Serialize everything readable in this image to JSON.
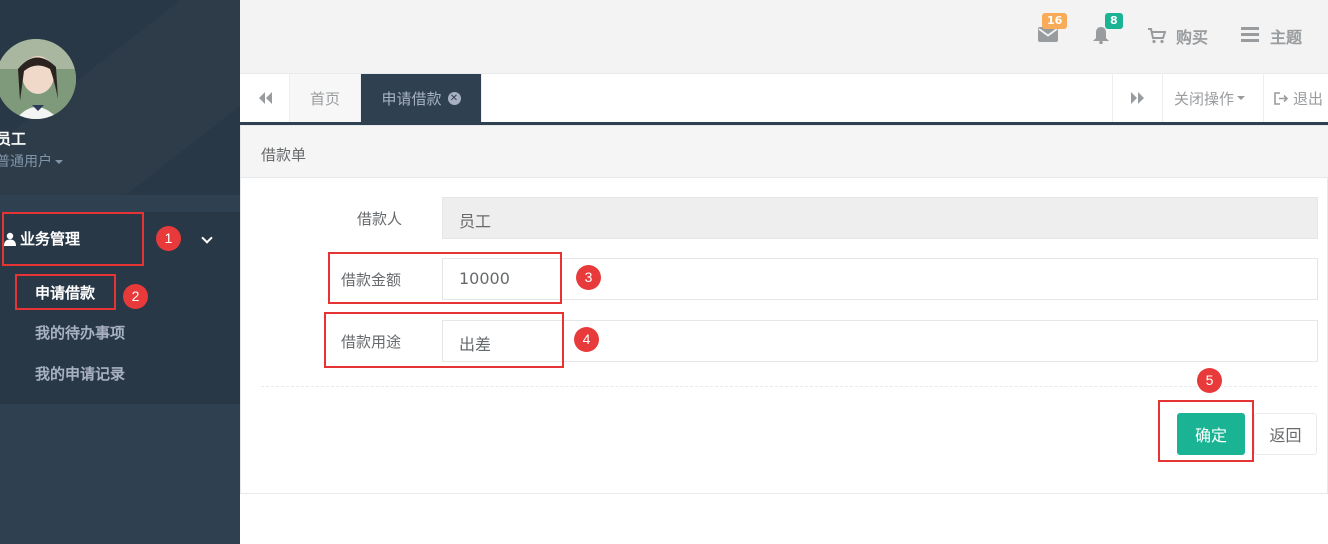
{
  "sidebar": {
    "user_name": "员工",
    "user_role": "普通用户",
    "menu_group": "业务管理",
    "items": [
      {
        "label": "申请借款",
        "active": true
      },
      {
        "label": "我的待办事项",
        "active": false
      },
      {
        "label": "我的申请记录",
        "active": false
      }
    ]
  },
  "topbar": {
    "mail_count": "16",
    "bell_count": "8",
    "buy_label": "购买",
    "theme_label": "主题"
  },
  "tabs": {
    "home": "首页",
    "active": "申请借款",
    "close_ops": "关闭操作",
    "logout": "退出"
  },
  "form": {
    "title": "借款单",
    "borrower_label": "借款人",
    "borrower_value": "员工",
    "amount_label": "借款金额",
    "amount_value": "10000",
    "purpose_label": "借款用途",
    "purpose_value": "出差",
    "confirm_label": "确定",
    "back_label": "返回"
  },
  "annotations": [
    "1",
    "2",
    "3",
    "4",
    "5"
  ],
  "colors": {
    "sidebar": "#2f4050",
    "primary": "#1ab394",
    "mail_badge": "#f8ac59",
    "bell_badge": "#1ab394",
    "annotation": "#e63434"
  }
}
